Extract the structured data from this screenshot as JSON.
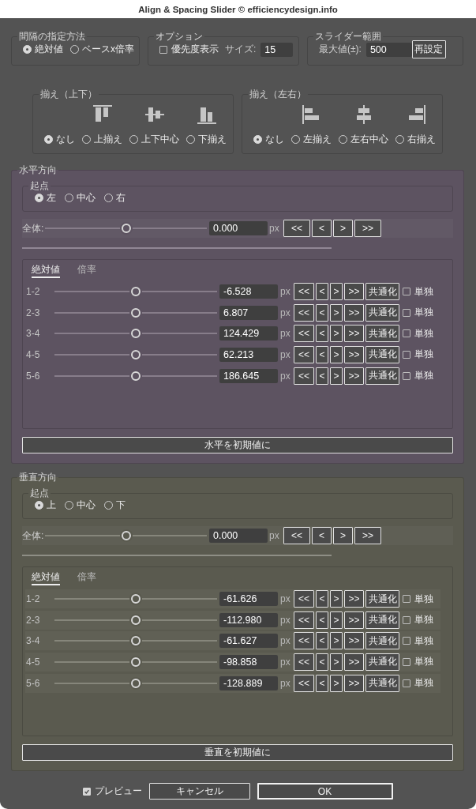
{
  "window": {
    "title": "Align & Spacing Slider © efficiencydesign.info"
  },
  "spacing_method": {
    "label": "間隔の指定方法",
    "options": [
      {
        "label": "絶対値",
        "selected": true
      },
      {
        "label": "ベースx倍率",
        "selected": false
      }
    ]
  },
  "options": {
    "label": "オプション",
    "priority_display": {
      "label": "優先度表示",
      "checked": false
    },
    "size": {
      "label": "サイズ:",
      "value": "15"
    }
  },
  "slider_range": {
    "label": "スライダー範囲",
    "max_value": {
      "label": "最大値(±):",
      "value": "500"
    },
    "reset_button": "再設定"
  },
  "align_vertical": {
    "label": "揃え（上下）",
    "options": [
      {
        "kind": "none",
        "label": "なし",
        "selected": true
      },
      {
        "kind": "top",
        "label": "上揃え",
        "selected": false
      },
      {
        "kind": "middle",
        "label": "上下中心",
        "selected": false
      },
      {
        "kind": "bottom",
        "label": "下揃え",
        "selected": false
      }
    ]
  },
  "align_horizontal": {
    "label": "揃え（左右）",
    "options": [
      {
        "kind": "none",
        "label": "なし",
        "selected": true
      },
      {
        "kind": "left",
        "label": "左揃え",
        "selected": false
      },
      {
        "kind": "center",
        "label": "左右中心",
        "selected": false
      },
      {
        "kind": "right",
        "label": "右揃え",
        "selected": false
      }
    ]
  },
  "horizontal": {
    "label": "水平方向",
    "origin": {
      "label": "起点",
      "options": [
        {
          "label": "左",
          "selected": true
        },
        {
          "label": "中心",
          "selected": false
        },
        {
          "label": "右",
          "selected": false
        }
      ]
    },
    "overall": {
      "label": "全体:",
      "level": 0.5,
      "value": "0.000",
      "unit": "px",
      "step_buttons": [
        "<<",
        "<",
        ">",
        ">>"
      ]
    },
    "tabs": [
      {
        "label": "絶対値",
        "selected": true
      },
      {
        "label": "倍率",
        "selected": false
      }
    ],
    "rows": [
      {
        "label": "1-2",
        "level": 0.5,
        "value": "-6.528",
        "unit": "px",
        "step_buttons": [
          "<<",
          "<",
          ">",
          ">>"
        ],
        "unify_button": "共通化",
        "single": {
          "label": "単独",
          "checked": false
        }
      },
      {
        "label": "2-3",
        "level": 0.5,
        "value": "6.807",
        "unit": "px",
        "step_buttons": [
          "<<",
          "<",
          ">",
          ">>"
        ],
        "unify_button": "共通化",
        "single": {
          "label": "単独",
          "checked": false
        }
      },
      {
        "label": "3-4",
        "level": 0.5,
        "value": "124.429",
        "unit": "px",
        "step_buttons": [
          "<<",
          "<",
          ">",
          ">>"
        ],
        "unify_button": "共通化",
        "single": {
          "label": "単独",
          "checked": false
        }
      },
      {
        "label": "4-5",
        "level": 0.5,
        "value": "62.213",
        "unit": "px",
        "step_buttons": [
          "<<",
          "<",
          ">",
          ">>"
        ],
        "unify_button": "共通化",
        "single": {
          "label": "単独",
          "checked": false
        }
      },
      {
        "label": "5-6",
        "level": 0.5,
        "value": "186.645",
        "unit": "px",
        "step_buttons": [
          "<<",
          "<",
          ">",
          ">>"
        ],
        "unify_button": "共通化",
        "single": {
          "label": "単独",
          "checked": false
        }
      }
    ],
    "reset_button": "水平を初期値に"
  },
  "vertical": {
    "label": "垂直方向",
    "origin": {
      "label": "起点",
      "options": [
        {
          "label": "上",
          "selected": true
        },
        {
          "label": "中心",
          "selected": false
        },
        {
          "label": "下",
          "selected": false
        }
      ]
    },
    "overall": {
      "label": "全体:",
      "level": 0.5,
      "value": "0.000",
      "unit": "px",
      "step_buttons": [
        "<<",
        "<",
        ">",
        ">>"
      ]
    },
    "tabs": [
      {
        "label": "絶対値",
        "selected": true
      },
      {
        "label": "倍率",
        "selected": false
      }
    ],
    "rows": [
      {
        "label": "1-2",
        "level": 0.5,
        "value": "-61.626",
        "unit": "px",
        "step_buttons": [
          "<<",
          "<",
          ">",
          ">>"
        ],
        "unify_button": "共通化",
        "single": {
          "label": "単独",
          "checked": false
        }
      },
      {
        "label": "2-3",
        "level": 0.5,
        "value": "-112.980",
        "unit": "px",
        "step_buttons": [
          "<<",
          "<",
          ">",
          ">>"
        ],
        "unify_button": "共通化",
        "single": {
          "label": "単独",
          "checked": false
        }
      },
      {
        "label": "3-4",
        "level": 0.5,
        "value": "-61.627",
        "unit": "px",
        "step_buttons": [
          "<<",
          "<",
          ">",
          ">>"
        ],
        "unify_button": "共通化",
        "single": {
          "label": "単独",
          "checked": false
        }
      },
      {
        "label": "4-5",
        "level": 0.5,
        "value": "-98.858",
        "unit": "px",
        "step_buttons": [
          "<<",
          "<",
          ">",
          ">>"
        ],
        "unify_button": "共通化",
        "single": {
          "label": "単独",
          "checked": false
        }
      },
      {
        "label": "5-6",
        "level": 0.5,
        "value": "-128.889",
        "unit": "px",
        "step_buttons": [
          "<<",
          "<",
          ">",
          ">>"
        ],
        "unify_button": "共通化",
        "single": {
          "label": "単独",
          "checked": false
        }
      }
    ],
    "reset_button": "垂直を初期値に"
  },
  "footer": {
    "preview": {
      "label": "プレビュー",
      "checked": true
    },
    "cancel_button": "キャンセル",
    "ok_button": "OK"
  }
}
